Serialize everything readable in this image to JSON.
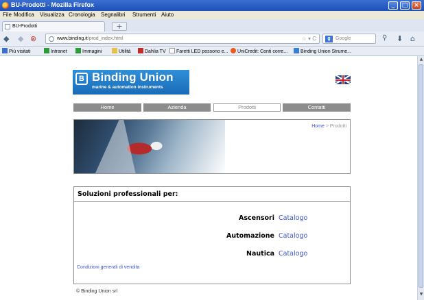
{
  "window": {
    "title": "BU-Prodotti - Mozilla Firefox"
  },
  "menu": [
    "File",
    "Modifica",
    "Visualizza",
    "Cronologia",
    "Segnalibri",
    "Strumenti",
    "Aiuto"
  ],
  "tab": {
    "label": "BU-Prodotti",
    "new_tab_label": "+"
  },
  "navbar": {
    "url_host": "www.binding.it",
    "url_path": "/prod_index.html",
    "search_placeholder": "Google"
  },
  "bookmarks": [
    {
      "label": "Più visitati",
      "color": "#3b6fd1"
    },
    {
      "label": "Intranet",
      "color": "#2e9a3a"
    },
    {
      "label": "Immagini",
      "color": "#2e9a3a"
    },
    {
      "label": "Utilità",
      "color": "#e6c24a"
    },
    {
      "label": "Dahlia TV",
      "color": "#c42b2b"
    },
    {
      "label": "Faretti LED possono e...",
      "color": "#ffffff"
    },
    {
      "label": "UniCredit: Conti corre...",
      "color": "#e85a1e"
    },
    {
      "label": "Binding Union Strume...",
      "color": "#3b7fd1"
    }
  ],
  "site": {
    "logo": {
      "name": "Binding Union",
      "tagline": "marine & automation instruments"
    },
    "nav": [
      "Home",
      "Azienda",
      "Prodotti",
      "Contatti"
    ],
    "active_nav": "Prodotti",
    "breadcrumb": {
      "home": "Home",
      "separator": " > ",
      "current": "Prodotti"
    },
    "content": {
      "heading": "Soluzioni professionali per:",
      "rows": [
        {
          "label": "Ascensori",
          "link": "Catalogo"
        },
        {
          "label": "Automazione",
          "link": "Catalogo"
        },
        {
          "label": "Nautica",
          "link": "Catalogo"
        }
      ],
      "conditions_link": "Condizioni generali di vendita"
    },
    "footer": "© Binding Union srl"
  },
  "colors": {
    "accent_link": "#3a55c9",
    "logo_bg": "#1a6bb7",
    "nav_bg": "#8c8c8c"
  }
}
